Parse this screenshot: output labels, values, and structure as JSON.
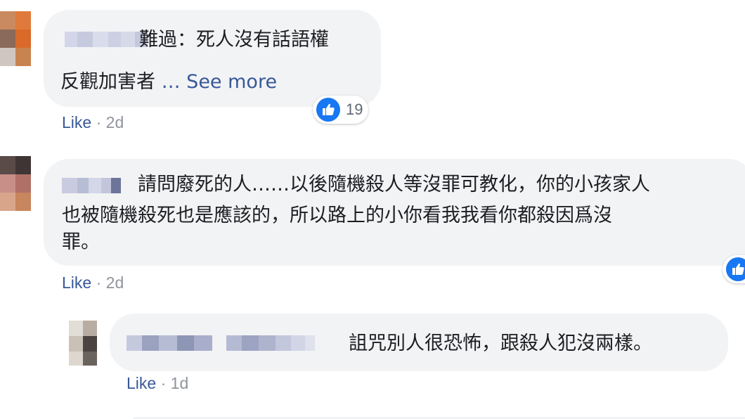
{
  "comments": [
    {
      "text_line1": "難過：死人沒有話語權",
      "text_line2": "反觀加害者",
      "see_more": "… See more",
      "like": "Like",
      "separator": "·",
      "time": "2d",
      "reaction_count": "19",
      "reaction_icon": "thumbs-up-icon"
    },
    {
      "text_line1": "請問廢死的人……以後隨機殺人等沒罪可教化，你的小孩家人",
      "text_line2": "也被隨機殺死也是應該的，所以路上的小你看我我看你都殺因爲沒",
      "text_line3": "罪。",
      "like": "Like",
      "separator": "·",
      "time": "2d",
      "reaction_icon": "thumbs-up-icon"
    },
    {
      "text_line1": "詛咒別人很恐怖，跟殺人犯沒兩樣。",
      "like": "Like",
      "separator": "·",
      "time": "1d"
    }
  ],
  "colors": {
    "bubble": "#f2f3f5",
    "link": "#385898",
    "meta_gray": "#90949c",
    "like_blue": "#1877f2"
  }
}
